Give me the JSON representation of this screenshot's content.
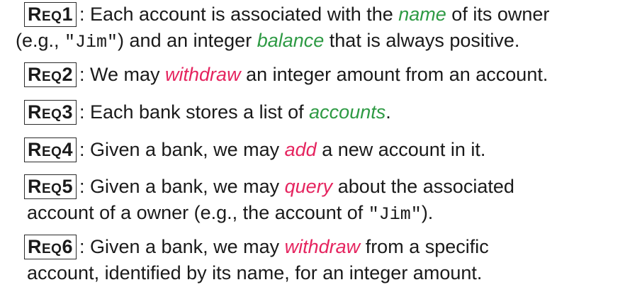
{
  "requirements": [
    {
      "tag": "Req1",
      "sep": ":",
      "line1": {
        "t1": "Each account is associated with the ",
        "k1": "name",
        "t2": " of its owner"
      },
      "line2": {
        "t1": "(e.g., ",
        "code": "\"Jim\"",
        "t2": ") and an integer ",
        "k1": "balance",
        "t3": " that is always positive."
      }
    },
    {
      "tag": "Req2",
      "sep": ":",
      "t1": "We may ",
      "k1": "withdraw",
      "t2": " an integer amount from an account."
    },
    {
      "tag": "Req3",
      "sep": ":",
      "t1": "Each bank stores a list of ",
      "k1": "accounts",
      "t2": "."
    },
    {
      "tag": "Req4",
      "sep": ":",
      "t1": "Given a bank, we may ",
      "k1": "add",
      "t2": " a new account in it."
    },
    {
      "tag": "Req5",
      "sep": ":",
      "line1": {
        "t1": "Given a bank, we may ",
        "k1": "query",
        "t2": " about the associated"
      },
      "line2": {
        "t1": "account of a owner (e.g., the account of ",
        "code": "\"Jim\"",
        "t2": ")."
      }
    },
    {
      "tag": "Req6",
      "sep": ":",
      "line1": {
        "t1": "Given a bank, we may ",
        "k1": "withdraw",
        "t2": " from a specific"
      },
      "line2": {
        "t1": "account, identified by its name, for an integer amount."
      }
    }
  ],
  "colors": {
    "keyword_green": "#2e9a44",
    "keyword_pink": "#e5245f",
    "text": "#1a1a1a",
    "tag_border": "#2b2b2b"
  }
}
